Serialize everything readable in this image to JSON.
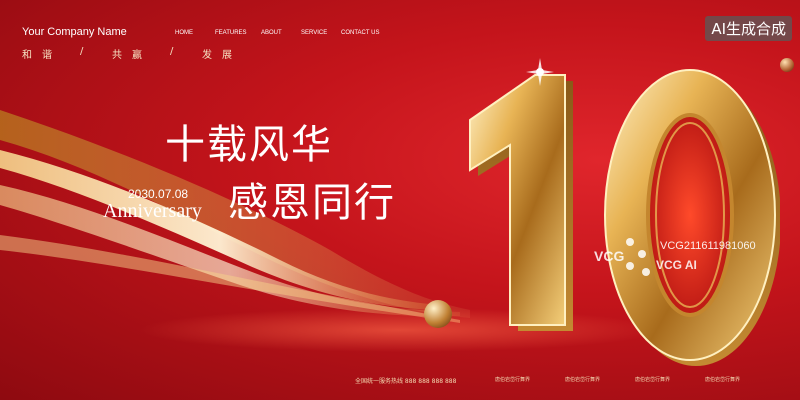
{
  "header": {
    "company": "Your Company Name",
    "slogan": [
      "和",
      "谐",
      "/",
      "共",
      "赢",
      "/",
      "发",
      "展"
    ],
    "nav": [
      "HOME",
      "FEATURES",
      "ABOUT",
      "SERVICE",
      "CONTACT US"
    ]
  },
  "badge": "AI生成合成",
  "headline": {
    "line1": "十载风华",
    "line2": "感恩同行"
  },
  "date": "2030.07.08",
  "anniversary": "Anniversary",
  "big_number": "10",
  "watermark": {
    "brand": "VCG",
    "brand2": "VCG AI",
    "id": "VCG211611981060"
  },
  "footer": {
    "hotline": "全国统一服务热线 888 888 888 888",
    "items": [
      "唐伯岩岱行舞界",
      "唐伯岩岱行舞界",
      "唐伯岩岱行舞界",
      "唐伯岩岱行舞界"
    ]
  },
  "colors": {
    "background": "#c4141b",
    "gold": "#d9a441",
    "text": "#ffffff"
  }
}
